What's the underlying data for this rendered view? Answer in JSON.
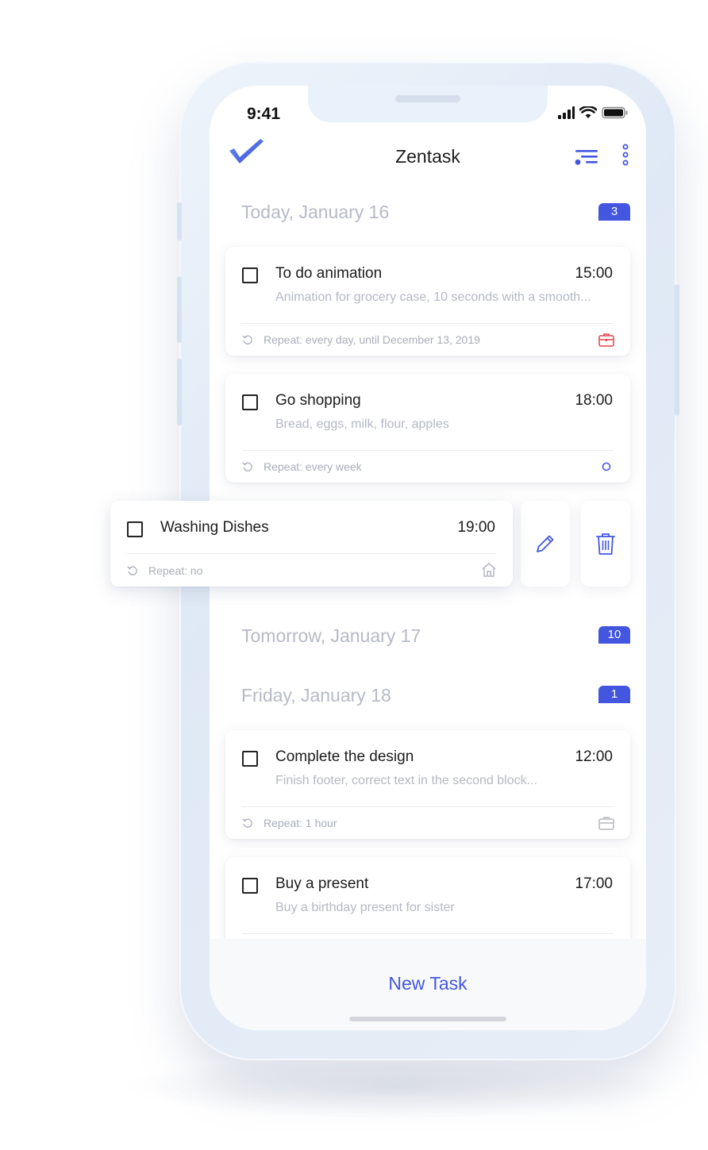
{
  "status_bar": {
    "time": "9:41"
  },
  "header": {
    "title": "Zentask"
  },
  "sections": [
    {
      "title": "Today, January 16",
      "count": "3"
    },
    {
      "title": "Tomorrow, January 17",
      "count": "10"
    },
    {
      "title": "Friday, January 18",
      "count": "1"
    }
  ],
  "tasks": [
    {
      "title": "To do animation",
      "time": "15:00",
      "description": "Animation for grocery case, 10 seconds with a smooth...",
      "repeat": "Repeat: every day, until December 13, 2019",
      "tag_icon": "briefcase-icon",
      "tag_color": "#e0454b"
    },
    {
      "title": "Go shopping",
      "time": "18:00",
      "description": "Bread, eggs, milk, flour, apples",
      "repeat": "Repeat: every week",
      "tag_icon": "circle-icon",
      "tag_color": "#4356e0"
    },
    {
      "title": "Washing Dishes",
      "time": "19:00",
      "repeat": "Repeat: no",
      "tag_icon": "home-icon",
      "tag_color": "#b5b8c4"
    },
    {
      "title": "Complete the design",
      "time": "12:00",
      "description": "Finish footer, correct text in the second block...",
      "repeat": "Repeat: 1 hour",
      "tag_icon": "briefcase-icon",
      "tag_color": "#b5b8c4"
    },
    {
      "title": "Buy a present",
      "time": "17:00",
      "description": "Buy a birthday present for sister"
    }
  ],
  "actions": {
    "edit_icon": "pencil-icon",
    "delete_icon": "trash-icon"
  },
  "footer": {
    "new_task_label": "New Task"
  },
  "colors": {
    "accent": "#4356e0",
    "muted_text": "#b5b8c4",
    "work_tag": "#e0454b"
  }
}
